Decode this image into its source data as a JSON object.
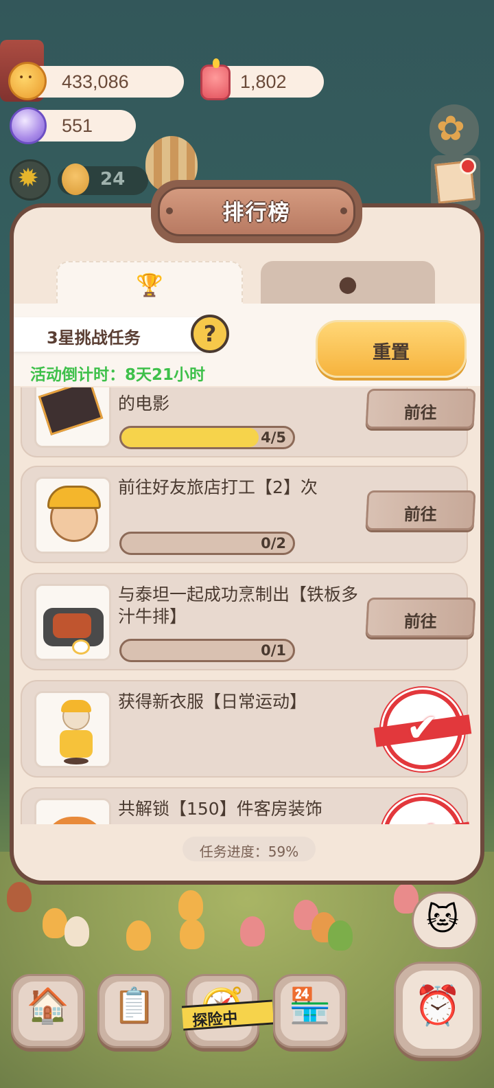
{
  "currencies": {
    "coins": "433,086",
    "candles": "1,802",
    "gems": "551"
  },
  "side_counter": "24",
  "panel": {
    "title": "排行榜",
    "tabs": [
      {
        "icon": "trophy-icon"
      },
      {
        "icon": "cookie-icon"
      }
    ],
    "challenge_label": "3星挑战任务",
    "help_symbol": "?",
    "countdown": "活动倒计时：8天21小时",
    "reset_label": "重置",
    "tasks": [
      {
        "title": "的电影",
        "progress_text": "4/5",
        "progress": 0.8,
        "action": "前往",
        "done": false,
        "icon": "clapperboard-icon"
      },
      {
        "title": "前往好友旅店打工【2】次",
        "progress_text": "0/2",
        "progress": 0,
        "action": "前往",
        "done": false,
        "icon": "worker-icon"
      },
      {
        "title": "与泰坦一起成功烹制出【铁板多汁牛排】",
        "progress_text": "0/1",
        "progress": 0,
        "action": "前往",
        "done": false,
        "icon": "steak-icon"
      },
      {
        "title": "获得新衣服【日常运动】",
        "done": true,
        "icon": "outfit-icon"
      },
      {
        "title": "共解锁【150】件客房装饰",
        "done": true,
        "icon": "decoration-icon"
      }
    ],
    "task_progress": "任务进度：59%"
  },
  "bottom_nav": {
    "adventure_label": "探险中",
    "buttons": [
      "house-icon",
      "calendar-icon",
      "adventure-icon",
      "shop-icon",
      "alarm-icon"
    ]
  },
  "colors": {
    "panel_border": "#6d4a3d",
    "panel_bg": "#f4e6d9",
    "accent_yellow": "#f6c84a",
    "countdown_green": "#3ec04a",
    "stamp_red": "#e2383c"
  }
}
